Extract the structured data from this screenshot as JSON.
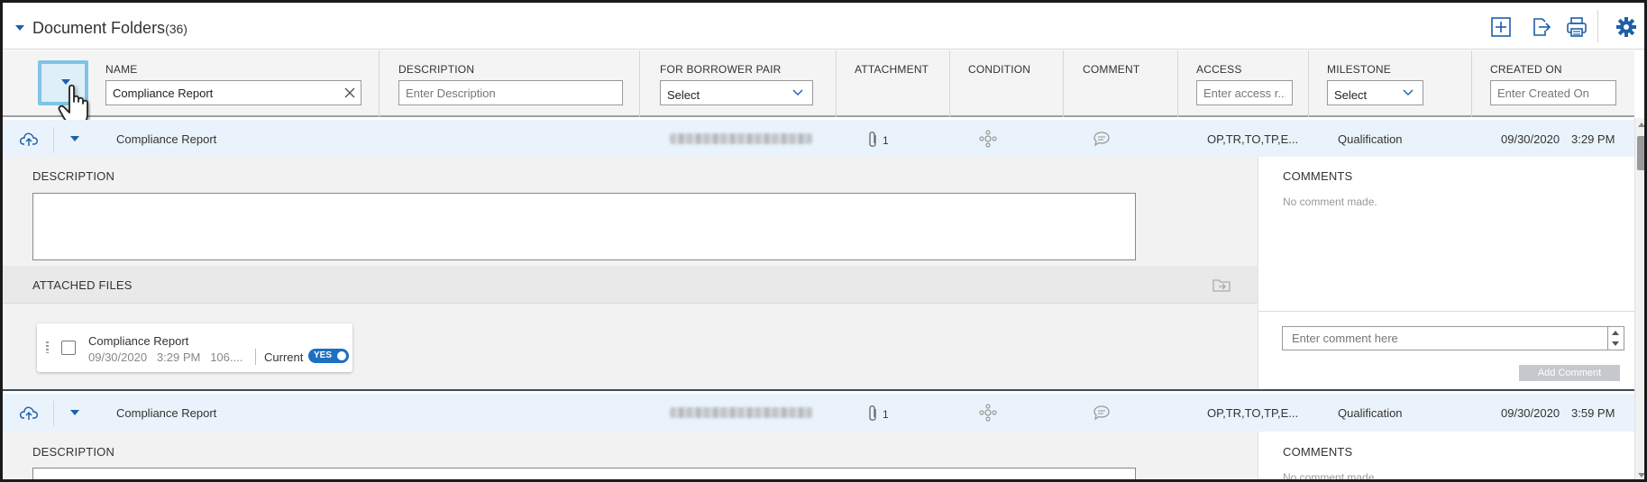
{
  "titlebar": {
    "title": "Document Folders",
    "count": "(36)",
    "icons": [
      "add-icon",
      "export-icon",
      "print-icon",
      "settings-icon"
    ]
  },
  "columns": {
    "name": {
      "label": "NAME",
      "value": "Compliance Report"
    },
    "description": {
      "label": "DESCRIPTION",
      "placeholder": "Enter Description"
    },
    "borrower_pair": {
      "label": "FOR BORROWER PAIR",
      "selected": "Select"
    },
    "attachment": {
      "label": "ATTACHMENT"
    },
    "condition": {
      "label": "CONDITION"
    },
    "comment": {
      "label": "COMMENT"
    },
    "access": {
      "label": "ACCESS",
      "placeholder": "Enter access r..."
    },
    "milestone": {
      "label": "MILESTONE",
      "selected": "Select"
    },
    "created_on": {
      "label": "CREATED ON",
      "placeholder": "Enter Created On"
    }
  },
  "rows": [
    {
      "name": "Compliance Report",
      "attachment_count": "1",
      "access": "OP,TR,TO,TP,E...",
      "milestone": "Qualification",
      "created_date": "09/30/2020",
      "created_time": "3:29 PM"
    },
    {
      "name": "Compliance Report",
      "attachment_count": "1",
      "access": "OP,TR,TO,TP,E...",
      "milestone": "Qualification",
      "created_date": "09/30/2020",
      "created_time": "3:59 PM"
    }
  ],
  "detail": {
    "description_title": "DESCRIPTION",
    "attached_files_title": "ATTACHED FILES",
    "file": {
      "name": "Compliance Report",
      "date": "09/30/2020",
      "time": "3:29 PM",
      "size": "106....",
      "current_label": "Current",
      "toggle": "YES"
    },
    "comments_title": "COMMENTS",
    "no_comment": "No comment made.",
    "comment_placeholder": "Enter comment here",
    "add_comment": "Add Comment"
  },
  "detail2": {
    "description_title": "DESCRIPTION",
    "comments_title": "COMMENTS",
    "no_comment": "No comment made."
  },
  "colors": {
    "accent": "#1d5fa8",
    "row_highlight": "#eaf3fb",
    "toggle_on": "#1d6fc2",
    "focus_ring": "#7fc4e6"
  }
}
